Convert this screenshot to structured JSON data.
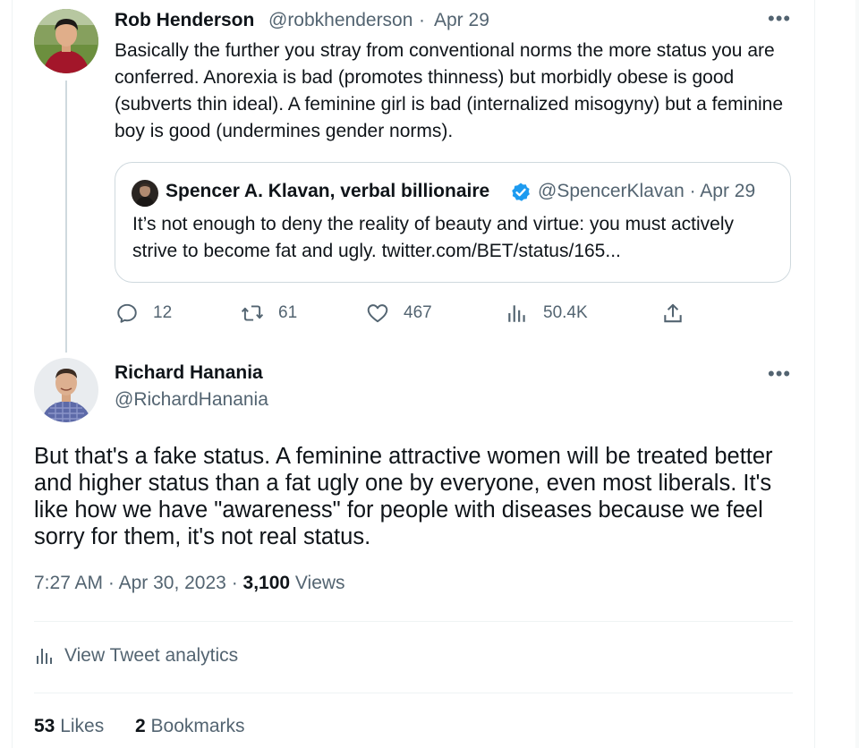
{
  "tweet1": {
    "author_name": "Rob Henderson",
    "author_handle": "@robkhenderson",
    "date": "Apr 29",
    "text": "Basically the further you stray from conventional norms the more status you are conferred. Anorexia is bad (promotes thinness) but morbidly obese is good (subverts thin ideal). A feminine girl is bad (internalized misogyny) but a feminine boy is good (undermines gender norms).",
    "more_icon": "more-horizontal-icon",
    "quote": {
      "author_name": "Spencer A. Klavan, verbal billionaire",
      "verified_icon": "verified-badge-icon",
      "author_handle": "@SpencerKlavan",
      "date": "Apr 29",
      "text": "It’s not enough to deny the reality of beauty and virtue: you must actively strive to become fat and ugly. twitter.com/BET/status/165..."
    },
    "actions": {
      "replies": "12",
      "retweets": "61",
      "likes": "467",
      "views": "50.4K"
    }
  },
  "tweet2": {
    "author_name": "Richard Hanania",
    "author_handle": "@RichardHanania",
    "text": "But that's a fake status. A feminine attractive women will be treated better and higher status than a fat ugly one by everyone, even most liberals. It's like how we have \"awareness\" for people with diseases because we feel sorry for them, it's not real status.",
    "time": "7:27 AM",
    "date": "Apr 30, 2023",
    "views_count": "3,100",
    "views_label": "Views",
    "analytics_label": "View Tweet analytics",
    "likes_count": "53",
    "likes_label": "Likes",
    "bookmarks_count": "2",
    "bookmarks_label": "Bookmarks"
  },
  "colors": {
    "text_primary": "#0f1419",
    "text_secondary": "#536471",
    "border": "#cfd9de",
    "verified_blue": "#1d9bf0"
  }
}
